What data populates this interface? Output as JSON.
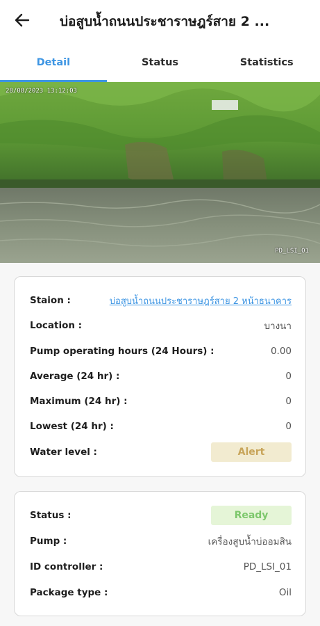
{
  "header": {
    "title": "บ่อสูบน้ำถนนประชาราษฎร์สาย 2 ...",
    "back_icon": "arrow-left-icon"
  },
  "tabs": [
    {
      "label": "Detail",
      "active": true
    },
    {
      "label": "Status",
      "active": false
    },
    {
      "label": "Statistics",
      "active": false
    }
  ],
  "camera": {
    "timestamp": "28/08/2023 13:12:03",
    "camera_id": "PD_LSI_01"
  },
  "detail": {
    "station_label": "Staion :",
    "station_value": "บ่อสูบน้ำถนนประชาราษฎร์สาย 2 หน้าธนาคาร",
    "location_label": "Location :",
    "location_value": "บางนา",
    "pump_hours_label": "Pump operating hours (24 Hours) :",
    "pump_hours_value": "0.00",
    "average_label": "Average (24 hr) :",
    "average_value": "0",
    "maximum_label": "Maximum (24 hr) :",
    "maximum_value": "0",
    "lowest_label": "Lowest (24 hr) :",
    "lowest_value": "0",
    "water_level_label": "Water level :",
    "water_level_value": "Alert"
  },
  "status_card": {
    "status_label": "Status :",
    "status_value": "Ready",
    "pump_label": "Pump :",
    "pump_value": "เครื่องสูบน้ำบ่ออมสิน",
    "controller_label": "ID controller :",
    "controller_value": "PD_LSI_01",
    "package_label": "Package type :",
    "package_value": "Oil"
  },
  "colors": {
    "accent": "#3d95e3",
    "alert_bg": "#f2ebd0",
    "alert_text": "#c8a55a",
    "ready_bg": "#e5f5d7",
    "ready_text": "#7cc76b"
  }
}
